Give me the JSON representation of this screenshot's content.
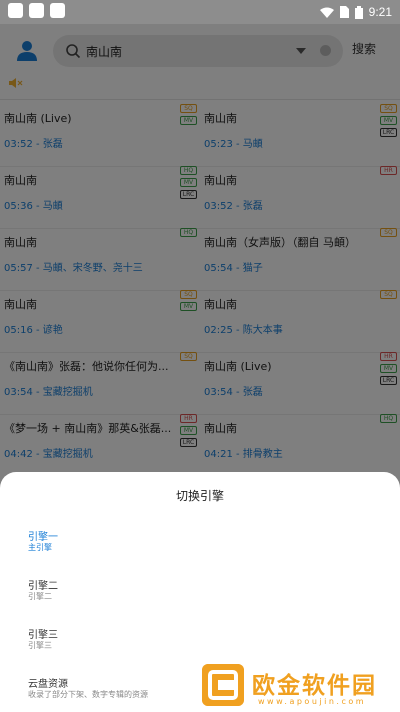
{
  "status_bar": {
    "time": "9:21"
  },
  "search": {
    "query": "南山南",
    "button_label": "搜索"
  },
  "songs": [
    {
      "title": "南山南 (Live)",
      "meta": "03:52 - 张磊",
      "badges": [
        "SQ",
        "MV"
      ]
    },
    {
      "title": "南山南",
      "meta": "05:23 - 马頔",
      "badges": [
        "SQ",
        "MV",
        "LRC"
      ]
    },
    {
      "title": "南山南",
      "meta": "05:36 - 马頔",
      "badges": [
        "HQ",
        "MV",
        "LRC"
      ]
    },
    {
      "title": "南山南",
      "meta": "03:52 - 张磊",
      "badges": [
        "HR"
      ]
    },
    {
      "title": "南山南",
      "meta": "05:57 - 马頔、宋冬野、尧十三",
      "badges": [
        "HQ"
      ]
    },
    {
      "title": "南山南（女声版）（翻自 马頔）",
      "meta": "05:54 - 猫子",
      "badges": [
        "SQ"
      ]
    },
    {
      "title": "南山南",
      "meta": "05:16 - 谚艳",
      "badges": [
        "SQ",
        "MV"
      ]
    },
    {
      "title": "南山南",
      "meta": "02:25 - 陈大本事",
      "badges": [
        "SQ"
      ]
    },
    {
      "title": "《南山南》张磊：他说你任何为...",
      "meta": "03:54 - 宝藏挖掘机",
      "badges": [
        "SQ"
      ]
    },
    {
      "title": "南山南 (Live)",
      "meta": "03:54 - 张磊",
      "badges": [
        "HR",
        "MV",
        "LRC"
      ]
    },
    {
      "title": "《梦一场 + 南山南》那英&张磊...",
      "meta": "04:42 - 宝藏挖掘机",
      "badges": [
        "HR",
        "MV",
        "LRC"
      ]
    },
    {
      "title": "南山南",
      "meta": "04:21 - 排骨教主",
      "badges": [
        "HQ"
      ]
    }
  ],
  "sheet": {
    "title": "切换引擎",
    "engines": [
      {
        "name": "引擎一",
        "sub": "主引擎"
      },
      {
        "name": "引擎二",
        "sub": "引擎二"
      },
      {
        "name": "引擎三",
        "sub": "引擎三"
      },
      {
        "name": "云盘资源",
        "sub": "收录了部分下架、数字专辑的资源"
      }
    ]
  },
  "watermark": {
    "text": "欧金软件园",
    "url": "www.apoujin.com"
  }
}
